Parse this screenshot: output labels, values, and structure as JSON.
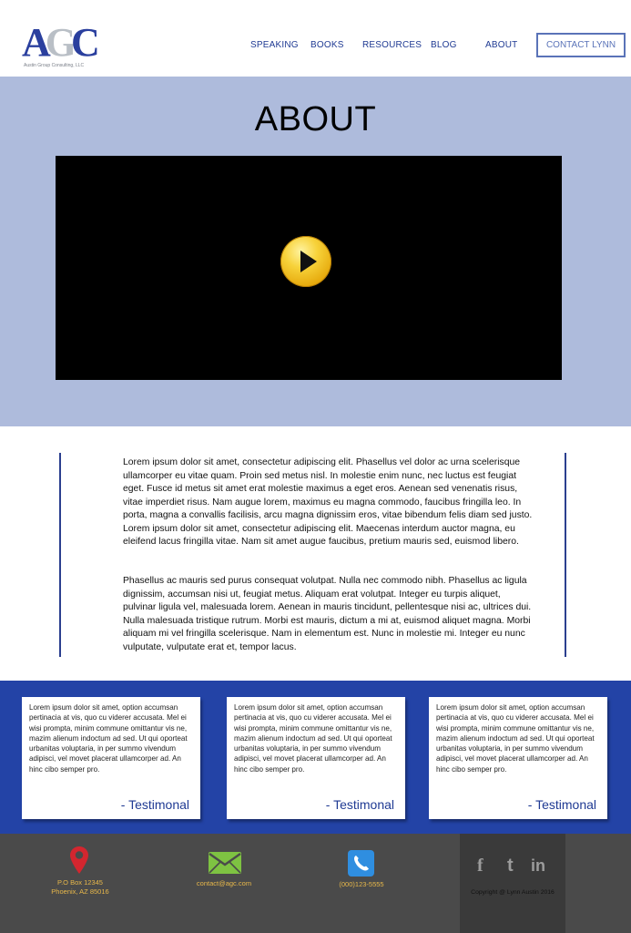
{
  "brand": {
    "logo_letters": [
      "A",
      "G",
      "C"
    ],
    "logo_tagline": "Austin Group Consulting, LLC",
    "colors": {
      "primary": "#2343a6",
      "hero_bg": "#aebbdc",
      "footer_bg": "#4a4a4a",
      "accent_gold": "#e8b84a"
    }
  },
  "nav": {
    "items": [
      "SPEAKING",
      "BOOKS",
      "RESOURCES",
      "BLOG",
      "ABOUT"
    ],
    "cta_label": "CONTACT LYNN"
  },
  "hero": {
    "title": "ABOUT",
    "video_control_icon": "play-button-icon"
  },
  "content": {
    "paragraph_1": "Lorem ipsum dolor sit amet, consectetur adipiscing elit. Phasellus vel dolor ac urna scelerisque ullamcorper eu vitae quam. Proin sed metus nisl. In molestie enim nunc, nec luctus est feugiat eget. Fusce id metus sit amet erat molestie maximus a eget eros. Aenean sed venenatis risus, vitae imperdiet risus. Nam augue lorem, maximus eu magna commodo, faucibus fringilla leo. In porta, magna a convallis facilisis, arcu magna dignissim eros, vitae bibendum felis diam sed justo. Lorem ipsum dolor sit amet, consectetur adipiscing elit. Maecenas interdum auctor magna, eu eleifend lacus fringilla vitae. Nam sit amet augue faucibus, pretium mauris sed, euismod libero.",
    "paragraph_2": "Phasellus ac mauris sed purus consequat volutpat. Nulla nec commodo nibh. Phasellus ac ligula dignissim, accumsan nisi ut, feugiat metus. Aliquam erat volutpat. Integer eu turpis aliquet, pulvinar ligula vel, malesuada lorem. Aenean in mauris tincidunt, pellentesque nisi ac, ultrices dui. Nulla malesuada tristique rutrum. Morbi est mauris, dictum a mi at, euismod aliquet magna. Morbi aliquam mi vel fringilla scelerisque. Nam in elementum est. Nunc in molestie mi. Integer eu nunc vulputate, vulputate erat et, tempor lacus."
  },
  "testimonials": [
    {
      "text": "Lorem ipsum dolor sit amet, option accumsan pertinacia at vis, quo cu viderer accusata. Mel ei wisi prompta, minim commune omittantur vis ne, mazim alienum indoctum ad sed. Ut qui oporteat urbanitas voluptaria, in per summo vivendum adipisci, vel movet placerat ullamcorper ad. An hinc cibo semper pro.",
      "signature": "- Testimonal"
    },
    {
      "text": "Lorem ipsum dolor sit amet, option accumsan pertinacia at vis, quo cu viderer accusata. Mel ei wisi prompta, minim commune omittantur vis ne, mazim alienum indoctum ad sed. Ut qui oporteat urbanitas voluptaria, in per summo vivendum adipisci, vel movet placerat ullamcorper ad. An hinc cibo semper pro.",
      "signature": "- Testimonal"
    },
    {
      "text": "Lorem ipsum dolor sit amet, option accumsan pertinacia at vis, quo cu viderer accusata. Mel ei wisi prompta, minim commune omittantur vis ne, mazim alienum indoctum ad sed. Ut qui oporteat urbanitas voluptaria, in per summo vivendum adipisci, vel movet placerat ullamcorper ad. An hinc cibo semper pro.",
      "signature": "- Testimonal"
    }
  ],
  "footer": {
    "address_line_1": "P.O Box 12345",
    "address_line_2": "Phoenix, AZ 85016",
    "email": "contact@agc.com",
    "phone": "(000)123-5555",
    "icons": [
      "map-pin-icon",
      "mail-icon",
      "phone-icon"
    ],
    "social": [
      "f",
      "t",
      "in"
    ],
    "copyright": "Copyright @ Lynn Austin 2016"
  }
}
